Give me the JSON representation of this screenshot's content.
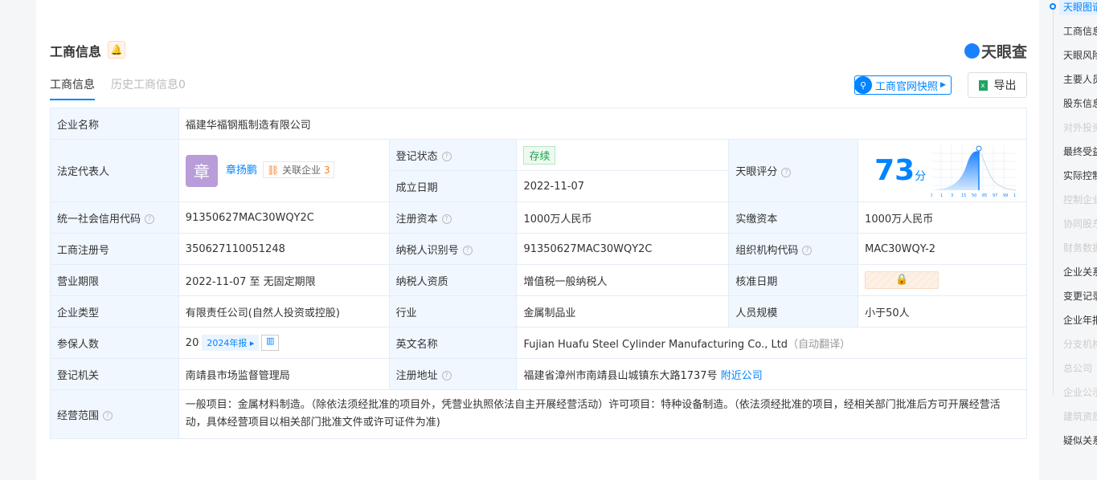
{
  "header": {
    "title": "工商信息",
    "brand": "天眼查",
    "tabs": [
      {
        "label": "工商信息"
      },
      {
        "label": "历史工商信息0"
      }
    ],
    "snapshot_label": "工商官网快照",
    "export_label": "导出"
  },
  "table": {
    "company_name_label": "企业名称",
    "company_name": "福建华福钢瓶制造有限公司",
    "legal_rep_label": "法定代表人",
    "legal_rep_avatar": "章",
    "legal_rep": "章扬鹏",
    "related_label": "关联企业",
    "related_count": "3",
    "reg_status_label": "登记状态",
    "reg_status": "存续",
    "found_date_label": "成立日期",
    "found_date": "2022-11-07",
    "score_label": "天眼评分",
    "score": "73",
    "score_unit": "分",
    "score_ticks": [
      "0",
      "1",
      "3",
      "15",
      "50",
      "85",
      "97",
      "99",
      "100"
    ],
    "credit_code_label": "统一社会信用代码",
    "credit_code": "91350627MAC30WQY2C",
    "reg_capital_label": "注册资本",
    "reg_capital": "1000万人民币",
    "paid_capital_label": "实缴资本",
    "paid_capital": "1000万人民币",
    "reg_no_label": "工商注册号",
    "reg_no": "350627110051248",
    "taxpayer_id_label": "纳税人识别号",
    "taxpayer_id": "91350627MAC30WQY2C",
    "org_code_label": "组织机构代码",
    "org_code": "MAC30WQY-2",
    "term_label": "营业期限",
    "term": "2022-11-07 至 无固定期限",
    "taxpayer_type_label": "纳税人资质",
    "taxpayer_type": "增值税一般纳税人",
    "approve_date_label": "核准日期",
    "company_type_label": "企业类型",
    "company_type": "有限责任公司(自然人投资或控股)",
    "industry_label": "行业",
    "industry": "金属制品业",
    "staff_size_label": "人员规模",
    "staff_size": "小于50人",
    "insured_label": "参保人数",
    "insured": "20",
    "insured_year": "2024年报",
    "english_name_label": "英文名称",
    "english_name": "Fujian Huafu Steel Cylinder Manufacturing Co., Ltd",
    "auto_translate": "（自动翻译）",
    "authority_label": "登记机关",
    "authority": "南靖县市场监督管理局",
    "address_label": "注册地址",
    "address": "福建省漳州市南靖县山城镇东大路1737号",
    "nearby": "附近公司",
    "scope_label": "经营范围",
    "scope": "一般项目：金属材料制造。（除依法须经批准的项目外，凭营业执照依法自主开展经营活动）许可项目：特种设备制造。（依法须经批准的项目，经相关部门批准后方可开展经营活动，具体经营项目以相关部门批准文件或许可证件为准)"
  },
  "sidebar": {
    "items": [
      {
        "label": "天眼图谱"
      },
      {
        "label": "工商信息"
      },
      {
        "label": "天眼风险"
      },
      {
        "label": "主要人员"
      },
      {
        "label": "股东信息"
      },
      {
        "label": "对外投资"
      },
      {
        "label": "最终受益人"
      },
      {
        "label": "实际控制人"
      },
      {
        "label": "控制企业"
      },
      {
        "label": "协同股东"
      },
      {
        "label": "财务数据"
      },
      {
        "label": "企业关系"
      },
      {
        "label": "变更记录"
      },
      {
        "label": "企业年报"
      },
      {
        "label": "分支机构"
      },
      {
        "label": "总公司"
      },
      {
        "label": "企业公示"
      },
      {
        "label": "建筑资质"
      },
      {
        "label": "疑似关系"
      }
    ]
  },
  "colors": {
    "accent": "#0084ff",
    "avatar": "#b89dd9",
    "status": "#19a24a"
  }
}
